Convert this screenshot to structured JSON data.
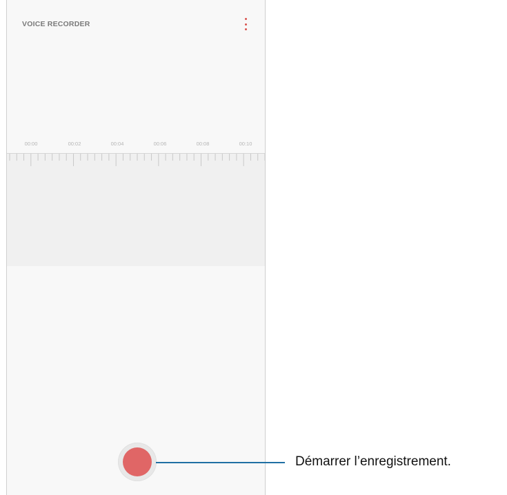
{
  "app": {
    "title": "VOICE RECORDER",
    "more_options_icon": "more-vertical-icon",
    "accent_color": "#d9534f"
  },
  "timeline": {
    "labels": [
      "00:00",
      "00:02",
      "00:04",
      "00:06",
      "00:08",
      "00:10"
    ]
  },
  "record": {
    "button_color": "#e06666",
    "icon": "record-icon"
  },
  "callout": {
    "text": "Démarrer l’enregistrement.",
    "line_color": "#1f6fa3"
  }
}
